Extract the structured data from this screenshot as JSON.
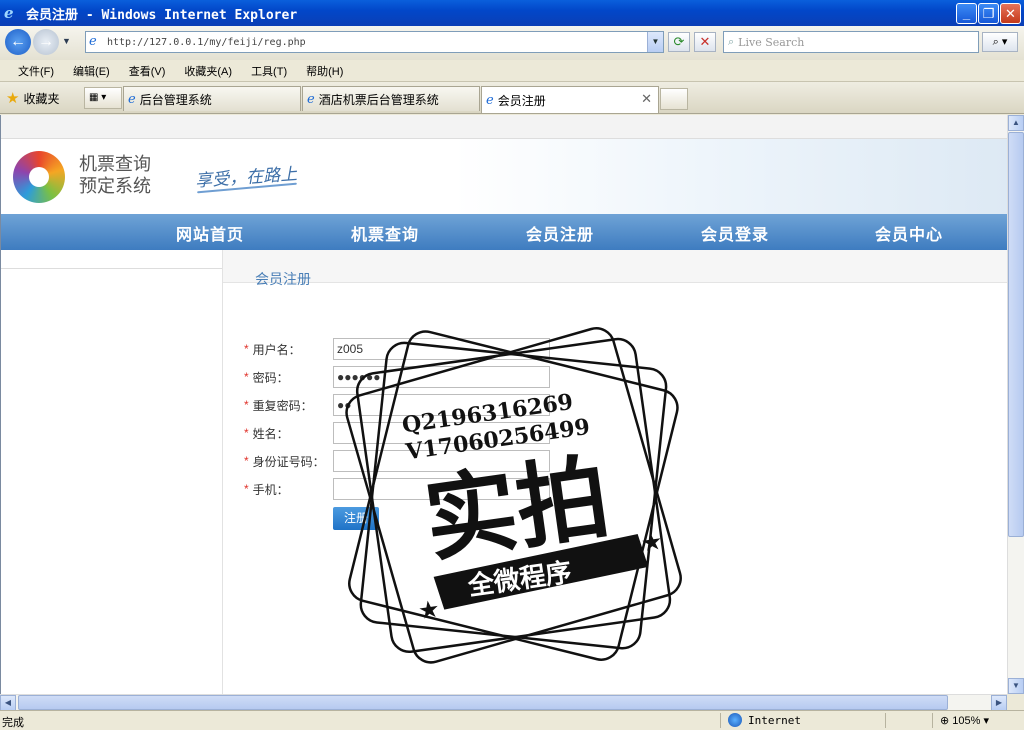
{
  "window": {
    "title": "会员注册 - Windows Internet Explorer"
  },
  "browser": {
    "address": "http://127.0.0.1/my/feiji/reg.php",
    "search_placeholder": "Live Search",
    "menu": [
      "文件(F)",
      "编辑(E)",
      "查看(V)",
      "收藏夹(A)",
      "工具(T)",
      "帮助(H)"
    ],
    "favorites_label": "收藏夹",
    "tabs": [
      {
        "label": "后台管理系统",
        "active": false
      },
      {
        "label": "酒店机票后台管理系统",
        "active": false
      },
      {
        "label": "会员注册",
        "active": true
      }
    ],
    "status_text": "完成",
    "zone": "Internet",
    "zoom": "105%"
  },
  "site": {
    "name_line1": "机票查询",
    "name_line2": "预定系统",
    "slogan": "享受，在路上",
    "nav": [
      "网站首页",
      "机票查询",
      "会员注册",
      "会员登录",
      "会员中心"
    ]
  },
  "form": {
    "section_title": "会员注册",
    "required_mark": "*",
    "fields": [
      {
        "label": "用户名：",
        "value": "z005"
      },
      {
        "label": "密码：",
        "value": "●●●●●●"
      },
      {
        "label": "重复密码：",
        "value": "●●"
      },
      {
        "label": "姓名：",
        "value": ""
      },
      {
        "label": "身份证号码：",
        "value": ""
      },
      {
        "label": "手机：",
        "value": ""
      }
    ],
    "submit_label": "注册"
  },
  "watermark": {
    "line1": "Q2196316269",
    "line2": "V17060256499",
    "big_text": "实拍",
    "banner": "全微程序"
  },
  "colors": {
    "title_bar": "#0A5FDC",
    "nav_bar": "#4A87C7",
    "required": "#E0322A",
    "submit": "#2A82D3",
    "section_title": "#4A7FB7"
  }
}
